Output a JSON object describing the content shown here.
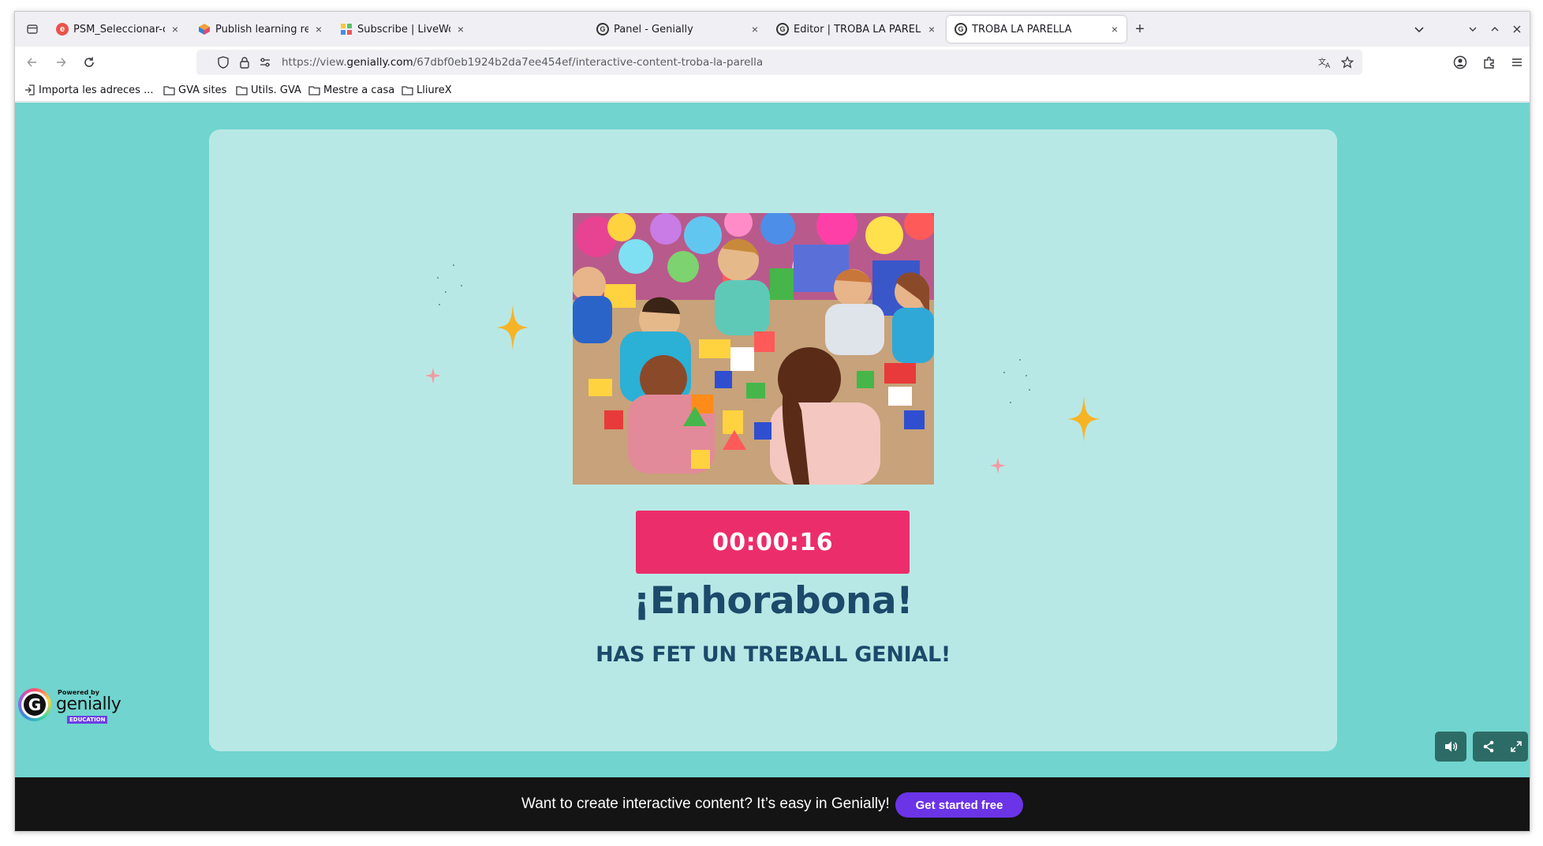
{
  "browser": {
    "tabs": [
      {
        "title": "PSM_Seleccionar-criteris-i-i",
        "favicon": "exe-icon",
        "active": false
      },
      {
        "title": "Publish learning resource",
        "favicon": "cube-icon",
        "active": false
      },
      {
        "title": "Subscribe | LiveWorksheets",
        "favicon": "liveworksheets-icon",
        "active": false
      },
      {
        "title": "Panel - Genially",
        "favicon": "genially-icon",
        "active": false
      },
      {
        "title": "Editor | TROBA LA PARELLA",
        "favicon": "genially-icon",
        "active": false
      },
      {
        "title": "TROBA LA PARELLA",
        "favicon": "genially-icon",
        "active": true
      }
    ],
    "new_tab_label": "+",
    "close_label": "×",
    "url_prefix": "https://view.",
    "url_domain": "genially.com",
    "url_path": "/67dbf0eb1924b2da7ee454ef/interactive-content-troba-la-parella",
    "bookmarks": [
      {
        "label": "Importa les adreces ...",
        "icon": "import-icon"
      },
      {
        "label": "GVA sites",
        "icon": "folder-icon"
      },
      {
        "label": "Utils. GVA",
        "icon": "folder-icon"
      },
      {
        "label": "Mestre a casa",
        "icon": "folder-icon"
      },
      {
        "label": "LliureX",
        "icon": "folder-icon"
      }
    ]
  },
  "content": {
    "timer": "00:00:16",
    "heading": "¡Enhorabona!",
    "subheading": "HAS FET UN TREBALL GENIAL!",
    "image_alt": "children playing with toy blocks and balloons"
  },
  "logo": {
    "powered": "Powered by",
    "brand": "genially",
    "badge": "EDUCATION"
  },
  "banner": {
    "text": "Want to create interactive content? It’s easy in Genially!",
    "button": "Get started free"
  },
  "colors": {
    "page_bg": "#71d4ce",
    "card_bg": "#b8e8e5",
    "timer_bg": "#ec2d6b",
    "heading": "#1b4a6b",
    "banner_bg": "#141414",
    "cta": "#6b34e6",
    "sparkle": "#f7b326"
  }
}
